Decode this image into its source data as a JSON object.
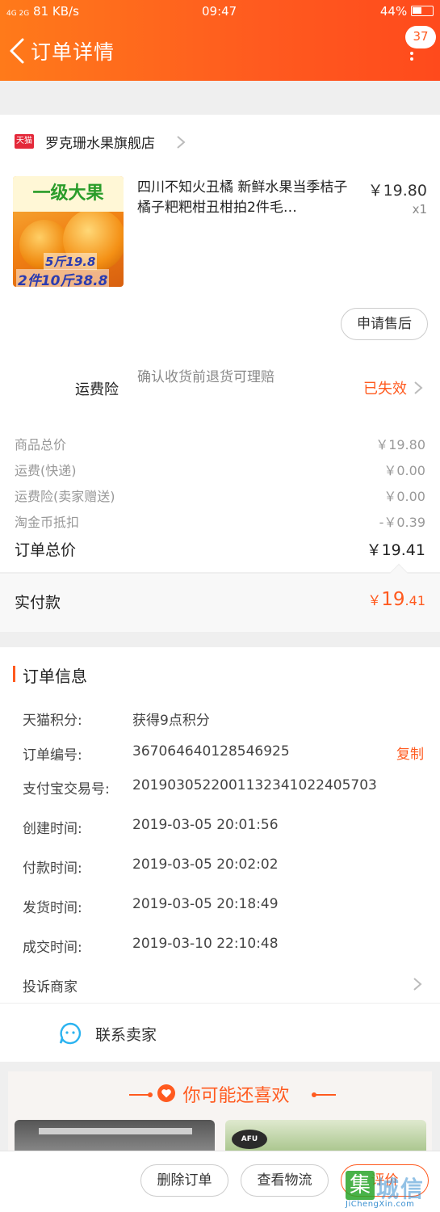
{
  "status_bar": {
    "network": "4G 2G",
    "speed": "81 KB/s",
    "time": "09:47",
    "battery": "44%"
  },
  "header": {
    "title": "订单详情",
    "badge_count": "37"
  },
  "store": {
    "tag": "天猫",
    "name": "罗克珊水果旗舰店"
  },
  "product": {
    "image_banner": "一级大果",
    "image_price_1": "5斤19.8",
    "image_price_2": "2件10斤38.8",
    "title": "四川不知火丑橘 新鲜水果当季桔子橘子粑粑柑丑柑拍2件毛…",
    "price": "￥19.80",
    "quantity": "x1",
    "after_sale_label": "申请售后"
  },
  "insurance": {
    "label": "运费险",
    "description": "确认收货前退货可理赔",
    "status": "已失效"
  },
  "price_summary": {
    "rows": [
      {
        "label": "商品总价",
        "value": "￥19.80"
      },
      {
        "label": "运费(快递)",
        "value": "￥0.00"
      },
      {
        "label": "运费险(卖家赠送)",
        "value": "￥0.00"
      },
      {
        "label": "淘金币抵扣",
        "value": "-￥0.39"
      }
    ],
    "total_label": "订单总价",
    "total_value": "￥19.41",
    "paid_label": "实付款",
    "paid_currency": "￥",
    "paid_int": "19",
    "paid_dec": ".41"
  },
  "order_info": {
    "title": "订单信息",
    "rows": [
      {
        "label": "天猫积分:",
        "value": "获得9点积分"
      },
      {
        "label": "订单编号:",
        "value": "367064640128546925"
      },
      {
        "label": "支付宝交易号:",
        "value": "2019030522001132341022405703"
      },
      {
        "label": "创建时间:",
        "value": "2019-03-05 20:01:56"
      },
      {
        "label": "付款时间:",
        "value": "2019-03-05 20:02:02"
      },
      {
        "label": "发货时间:",
        "value": "2019-03-05 20:18:49"
      },
      {
        "label": "成交时间:",
        "value": "2019-03-10 22:10:48"
      }
    ],
    "copy_label": "复制",
    "complain_label": "投诉商家"
  },
  "contact": {
    "label": "联系卖家"
  },
  "recommend": {
    "title": "你可能还喜欢",
    "brand_logo": "AFU"
  },
  "bottom_bar": {
    "delete_label": "删除订单",
    "logistics_label": "查看物流",
    "evaluate_label": "评价"
  },
  "watermark": {
    "glyph": "集",
    "text_cn": "城信",
    "text_en": "JiChengXin.com"
  },
  "colors": {
    "accent": "#ff5a1f",
    "header_start": "#ff7a1a",
    "tmall_red": "#e4293a"
  }
}
